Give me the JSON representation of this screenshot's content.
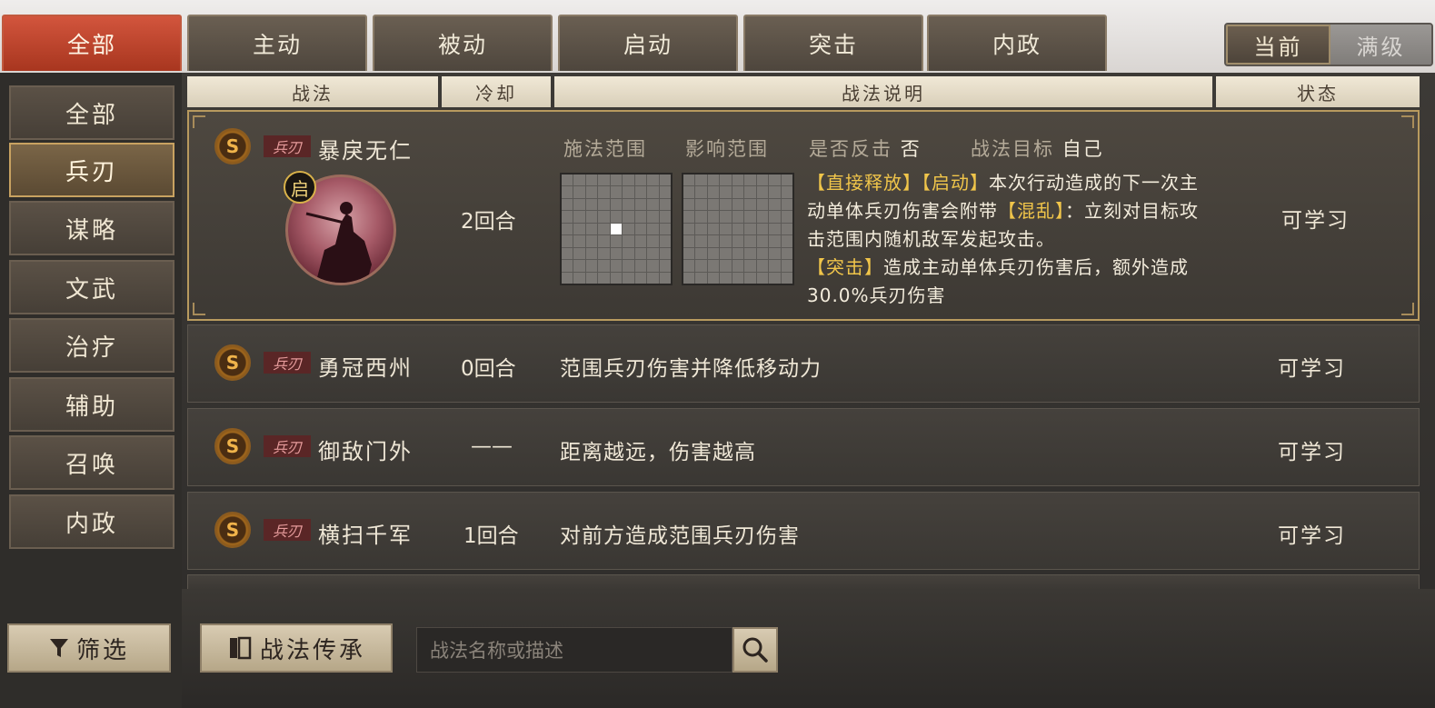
{
  "top_tabs": [
    "全部",
    "主动",
    "被动",
    "启动",
    "突击",
    "内政"
  ],
  "level_toggle": {
    "current": "当前",
    "max": "满级"
  },
  "sidebar": [
    "全部",
    "兵刃",
    "谋略",
    "文武",
    "治疗",
    "辅助",
    "召唤",
    "内政"
  ],
  "columns": {
    "name": "战法",
    "cooldown": "冷却",
    "desc": "战法说明",
    "status": "状态"
  },
  "selected": {
    "grade": "S",
    "type": "兵刃",
    "name": "暴戾无仁",
    "trigger_badge": "启",
    "cooldown": "2回合",
    "cast_range_label": "施法范围",
    "effect_range_label": "影响范围",
    "counter_label": "是否反击",
    "counter_value": "否",
    "target_label": "战法目标",
    "target_value": "自己",
    "tag1": "【直接释放】",
    "tag2": "【启动】",
    "text1": "本次行动造成的下一次主动单体兵刃伤害会附带",
    "tag3": "【混乱】",
    "text2": "：立刻对目标攻击范围内随机敌军发起攻击。",
    "tag4": "【突击】",
    "text3": "造成主动单体兵刃伤害后，额外造成30.0%兵刃伤害",
    "status": "可学习"
  },
  "rows": [
    {
      "grade": "S",
      "type": "兵刃",
      "name": "勇冠西州",
      "cooldown": "0回合",
      "desc": "范围兵刃伤害并降低移动力",
      "status": "可学习"
    },
    {
      "grade": "S",
      "type": "兵刃",
      "name": "御敌门外",
      "cooldown": "——",
      "desc": "距离越远，伤害越高",
      "status": "可学习"
    },
    {
      "grade": "S",
      "type": "兵刃",
      "name": "横扫千军",
      "cooldown": "1回合",
      "desc": "对前方造成范围兵刃伤害",
      "status": "可学习"
    }
  ],
  "filter_button": "筛选",
  "inherit_button": "战法传承",
  "search_placeholder": "战法名称或描述",
  "colors": {
    "active_tab": "#c4432b",
    "highlight": "#f0c54a",
    "selected_border": "#b89a5e"
  }
}
